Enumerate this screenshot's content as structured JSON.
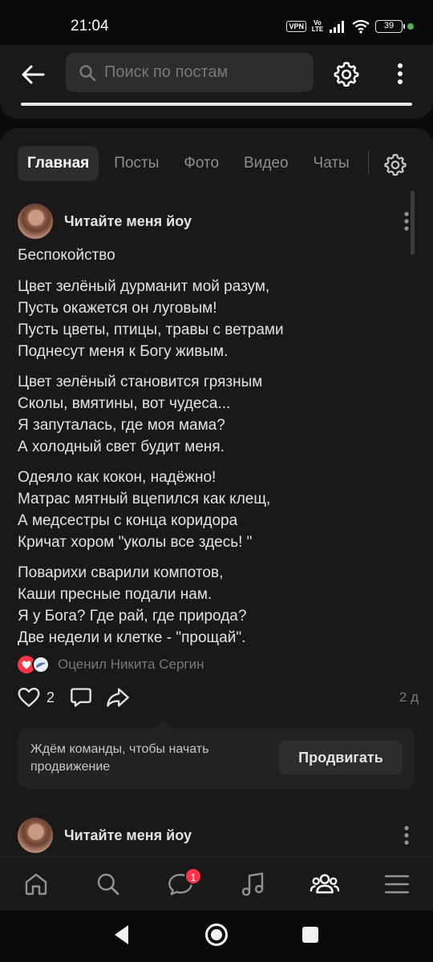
{
  "status_bar": {
    "time": "21:04",
    "vpn": "VPN",
    "volte_top": "Vo",
    "volte_bottom": "LTE",
    "battery": "39"
  },
  "header": {
    "search_placeholder": "Поиск по постам"
  },
  "tabs": [
    "Главная",
    "Посты",
    "Фото",
    "Видео",
    "Чаты"
  ],
  "post": {
    "author": "Читайте меня йоу",
    "title": "Беспокойство",
    "stanzas": [
      [
        "Цвет зелёный дурманит мой разум,",
        "Пусть окажется он луговым!",
        "Пусть цветы, птицы, травы с ветрами",
        "Поднесут меня к Богу живым."
      ],
      [
        "Цвет зелёный становится грязным",
        "Сколы, вмятины, вот чудеса...",
        "Я запуталась, где моя мама?",
        "А холодный свет будит меня."
      ],
      [
        "Одеяло как кокон, надёжно!",
        "Матрас мятный вцепился как клещ,",
        "А медсестры с конца коридора",
        "Кричат хором \"уколы все здесь! \""
      ],
      [
        "Поварихи сварили компотов,",
        "Каши пресные подали нам.",
        "Я у Бога? Где рай, где природа?",
        "Две недели и клетке - \"прощай\"."
      ]
    ],
    "liked_by": "Оценил Никита Сергин",
    "like_count": "2",
    "time": "2 д"
  },
  "promo": {
    "text": "Ждём команды, чтобы начать продвижение",
    "button": "Продвигать"
  },
  "next_post": {
    "author": "Читайте меня йоу"
  },
  "bottom_nav": {
    "items": [
      "home-icon",
      "search-icon",
      "messages-icon",
      "music-icon",
      "community-icon",
      "menu-icon"
    ],
    "messages_badge": "1",
    "active": "community-icon"
  },
  "colors": {
    "background": "#0a0a0a",
    "card": "#19191a",
    "text": "#e1e3e6",
    "secondary": "#76787a",
    "accent_red": "#ff3347"
  }
}
